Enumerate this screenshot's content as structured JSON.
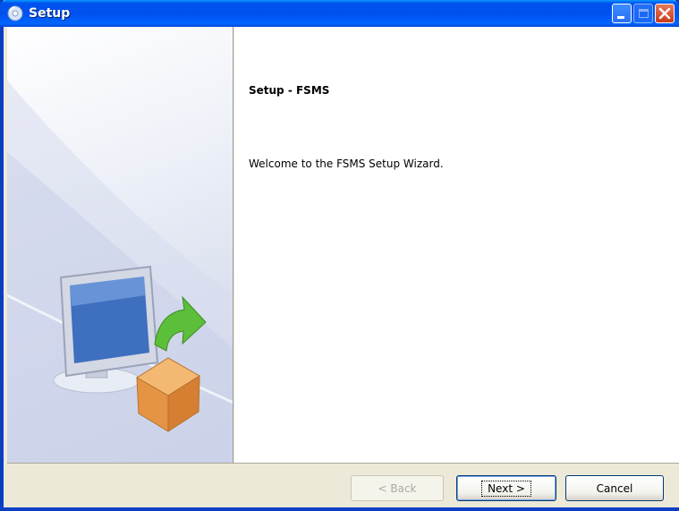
{
  "window": {
    "title": "Setup",
    "icon": "setup-disc-icon",
    "controls": {
      "minimize": "minimize-icon",
      "maximize": "maximize-icon",
      "close": "close-icon"
    }
  },
  "banner": {
    "illustration": "computer-box-arrow-illustration"
  },
  "content": {
    "heading": "Setup - FSMS",
    "welcome_text": "Welcome to the FSMS Setup Wizard."
  },
  "buttons": {
    "back_label": "< Back",
    "next_label": "Next >",
    "cancel_label": "Cancel"
  },
  "colors": {
    "titlebar": "#0053ee",
    "frame": "#0a3fc4",
    "dialog_bg": "#ece9d8"
  }
}
